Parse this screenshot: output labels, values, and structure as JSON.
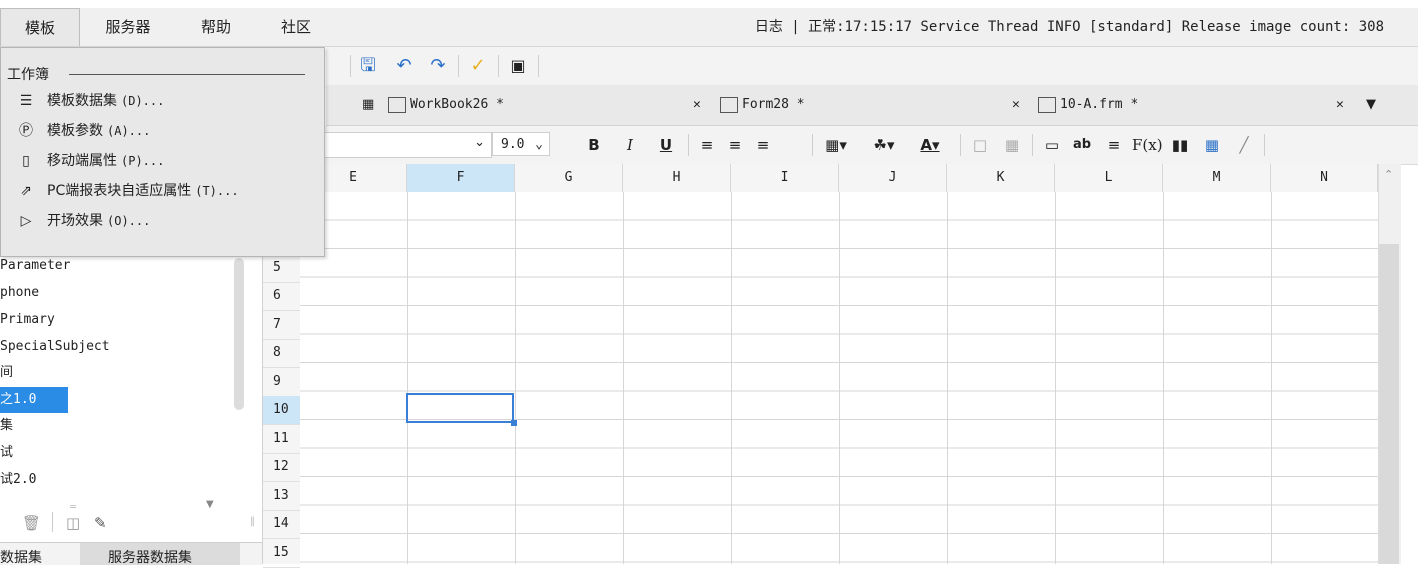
{
  "menubar": {
    "items": [
      "模板",
      "服务器",
      "帮助",
      "社区"
    ],
    "log": "日志 | 正常:17:15:17 Service Thread INFO [standard] Release image count: 308"
  },
  "dropdown": {
    "section": "工作簿",
    "items": [
      {
        "icon": "database-icon",
        "label": "模板数据集",
        "shortcut": "(D)..."
      },
      {
        "icon": "parameter-icon",
        "label": "模板参数",
        "shortcut": "(A)..."
      },
      {
        "icon": "mobile-icon",
        "label": "移动端属性",
        "shortcut": "(P)..."
      },
      {
        "icon": "resize-icon",
        "label": "PC端报表块自适应属性",
        "shortcut": "(T)..."
      },
      {
        "icon": "play-icon",
        "label": "开场效果",
        "shortcut": "(O)..."
      }
    ]
  },
  "tabs": [
    {
      "label": "WorkBook26 *",
      "icon": "workbook-icon"
    },
    {
      "label": "Form28 *",
      "icon": "form-icon"
    },
    {
      "label": "10-A.frm *",
      "icon": "form-icon"
    }
  ],
  "format": {
    "font_size": "9.0",
    "bold": "B",
    "italic": "I",
    "underline": "U"
  },
  "columns": [
    "E",
    "F",
    "G",
    "H",
    "I",
    "J",
    "K",
    "L",
    "M",
    "N"
  ],
  "selected_column": "F",
  "rows": [
    "5",
    "6",
    "7",
    "8",
    "9",
    "10",
    "11",
    "12",
    "13",
    "14",
    "15"
  ],
  "selected_row": "10",
  "datasets": [
    "Parameter",
    "phone",
    "Primary",
    "SpecialSubject",
    "间",
    "之1.0",
    "集",
    "试",
    "试2.0"
  ],
  "selected_dataset": "之1.0",
  "left_tabs": [
    "数据集",
    "服务器数据集"
  ],
  "colors": {
    "accent": "#2b8ce6",
    "selection": "#3a7fd6",
    "header_sel": "#cde6f7"
  }
}
